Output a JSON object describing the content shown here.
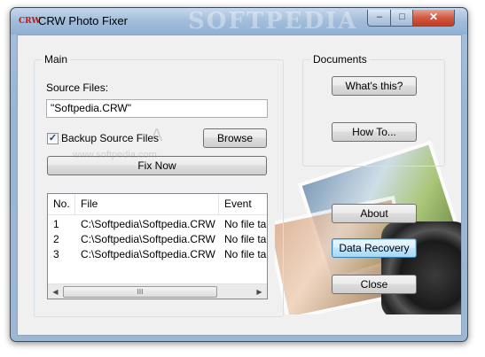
{
  "window": {
    "title": "CRW Photo Fixer",
    "icon": "crw-app-icon",
    "icon_text": "CRW",
    "title_watermark": "SOFTPEDIA",
    "controls": {
      "minimize": "–",
      "maximize": "□",
      "close": "✕"
    }
  },
  "main": {
    "group_label": "Main",
    "source_files_label": "Source Files:",
    "source_files_value": "\"Softpedia.CRW\"",
    "backup_label": "Backup Source Files",
    "backup_checked": true,
    "check_glyph": "✓",
    "browse_label": "Browse",
    "fix_now_label": "Fix Now",
    "watermark_text": "www.softpedia.com",
    "watermark_glyph": "A",
    "list": {
      "columns": [
        "No.",
        "File",
        "Event"
      ],
      "rows": [
        {
          "no": "1",
          "file": "C:\\Softpedia\\Softpedia.CRW",
          "event": "No file tail"
        },
        {
          "no": "2",
          "file": "C:\\Softpedia\\Softpedia.CRW",
          "event": "No file tail"
        },
        {
          "no": "3",
          "file": "C:\\Softpedia\\Softpedia.CRW",
          "event": "No file tail"
        }
      ],
      "scroll_left": "◀",
      "scroll_right": "▶",
      "thumb_grip": "III"
    }
  },
  "documents": {
    "group_label": "Documents",
    "whats_this_label": "What's this?",
    "how_to_label": "How To..."
  },
  "side_buttons": {
    "about_label": "About",
    "data_recovery_label": "Data Recovery",
    "close_label": "Close"
  },
  "colors": {
    "title_bar": "#a4bedb",
    "client_bg": "#f0f0f0",
    "focus_border": "#3c7fb1"
  }
}
